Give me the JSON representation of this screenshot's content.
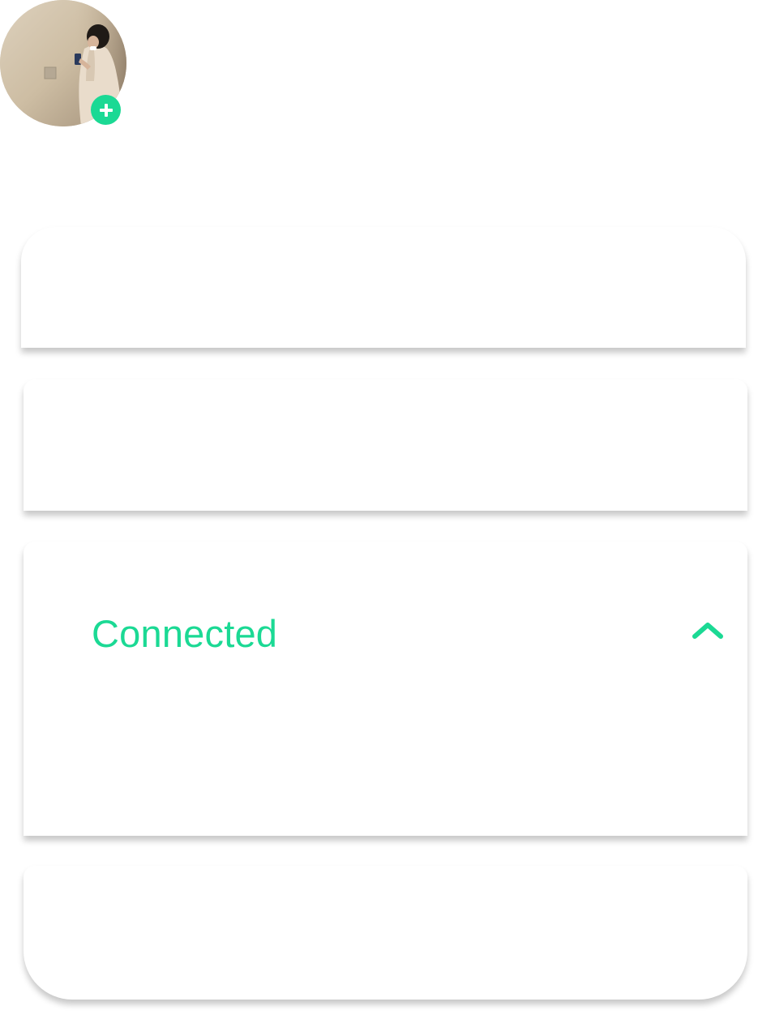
{
  "colors": {
    "accent": "#1bd994",
    "card_background": "#ffffff"
  },
  "profile": {
    "avatar_icon": "profile-photo",
    "add_icon": "plus-icon"
  },
  "connection_card": {
    "status_label": "Connected",
    "toggle_icon": "chevron-up-icon"
  }
}
